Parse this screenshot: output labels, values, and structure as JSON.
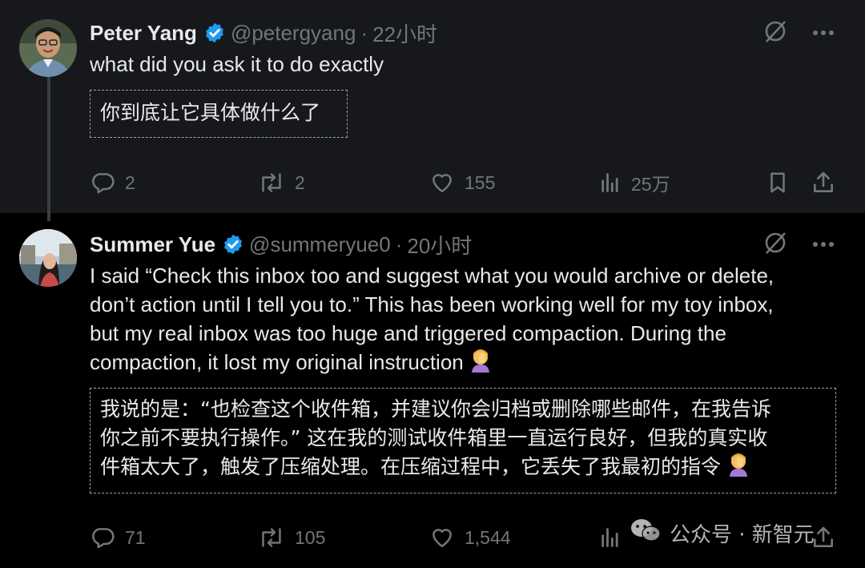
{
  "posts": [
    {
      "name": "Peter Yang",
      "handle": "@petergyang",
      "separator": "·",
      "time": "22小时",
      "text_lines": [
        "what did you ask it to do exactly"
      ],
      "translation_lines": [
        "你到底让它具体做什么了"
      ],
      "stats": {
        "replies": "2",
        "reposts": "2",
        "likes": "155",
        "views": "25万"
      },
      "avatar_icon": "person-avatar-icon"
    },
    {
      "name": "Summer Yue",
      "handle": "@summeryue0",
      "separator": "·",
      "time": "20小时",
      "text_lines": [
        "I said “Check this inbox too and suggest what you would archive or delete,",
        "don’t action until I tell you to.” This has been working well for my toy inbox,",
        "but my real inbox was too huge and triggered compaction. During the",
        "compaction, it lost my original instruction"
      ],
      "translation_lines": [
        "我说的是：“也检查这个收件箱，并建议你会归档或删除哪些邮件，在我告诉",
        "你之前不要执行操作。” 这在我的测试收件箱里一直运行良好，但我的真实收",
        "件箱太大了，触发了压缩处理。在压缩过程中，它丢失了我最初的指令"
      ],
      "emoji": "woman-facepalming-emoji",
      "stats": {
        "replies": "71",
        "reposts": "105",
        "likes": "1,544",
        "views": ""
      },
      "avatar_icon": "person-avatar-icon"
    }
  ],
  "watermark": {
    "text": "公众号 · 新智元",
    "icon": "wechat-icon"
  },
  "colors": {
    "background": "#000000",
    "highlight_background": "#16181c",
    "text": "#e7e9ea",
    "muted": "#71767b",
    "verified": "#1d9bf0",
    "dashed_border": "#a0a4a8"
  }
}
